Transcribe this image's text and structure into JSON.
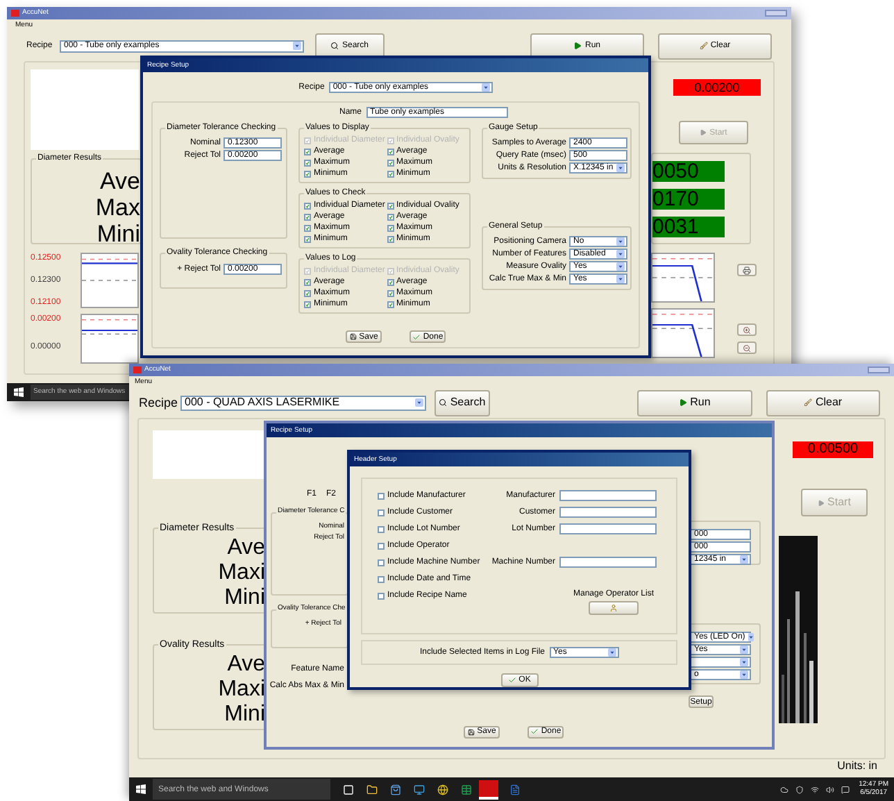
{
  "top_screen": {
    "window_title": "AccuNet",
    "menu": "Menu",
    "recipe_label": "Recipe",
    "recipe_value": "000 - Tube only examples",
    "search": "Search",
    "run": "Run",
    "clear": "Clear",
    "red_reading": "0.00200",
    "start": {
      "label": "Start",
      "disabled": true
    },
    "diameter_results": {
      "title": "Diameter Results",
      "rows": [
        "Ave",
        "Max",
        "Mini"
      ]
    },
    "green_readings": [
      "0050",
      "0170",
      "0031"
    ],
    "charts": [
      {
        "labels": [
          {
            "text": "0.12500",
            "limit": true
          },
          {
            "text": "0.12300",
            "limit": false
          },
          {
            "text": "0.12100",
            "limit": true
          }
        ]
      },
      {
        "labels": [
          {
            "text": "0.00200",
            "limit": true
          },
          {
            "text": "0.00000",
            "limit": false
          }
        ]
      }
    ],
    "taskbar_search": "Search the web and Windows",
    "recipe_setup": {
      "title": "Recipe Setup",
      "recipe_label": "Recipe",
      "recipe_value": "000 - Tube only examples",
      "name_label": "Name",
      "name_value": "Tube only examples",
      "diameter_tolerance": {
        "title": "Diameter Tolerance Checking",
        "fields": [
          {
            "label": "Nominal",
            "value": "0.12300"
          },
          {
            "label": "Reject Tol",
            "value": "0.00200"
          }
        ]
      },
      "ovality_tolerance": {
        "title": "Ovality Tolerance Checking",
        "fields": [
          {
            "label": "+ Reject Tol",
            "value": "0.00200"
          }
        ]
      },
      "value_groups": [
        {
          "title": "Values to Display",
          "items": [
            {
              "label": "Individual Diameter",
              "checked": true,
              "disabled": true
            },
            {
              "label": "Individual Ovality",
              "checked": true,
              "disabled": true
            },
            {
              "label": "Average",
              "checked": true,
              "disabled": false
            },
            {
              "label": "Average",
              "checked": true,
              "disabled": false
            },
            {
              "label": "Maximum",
              "checked": true,
              "disabled": false
            },
            {
              "label": "Maximum",
              "checked": true,
              "disabled": false
            },
            {
              "label": "Minimum",
              "checked": true,
              "disabled": false
            },
            {
              "label": "Minimum",
              "checked": true,
              "disabled": false
            }
          ]
        },
        {
          "title": "Values to Check",
          "items": [
            {
              "label": "Individual Diameter",
              "checked": true,
              "disabled": false
            },
            {
              "label": "Individual Ovality",
              "checked": true,
              "disabled": false
            },
            {
              "label": "Average",
              "checked": true,
              "disabled": false
            },
            {
              "label": "Average",
              "checked": true,
              "disabled": false
            },
            {
              "label": "Maximum",
              "checked": true,
              "disabled": false
            },
            {
              "label": "Maximum",
              "checked": true,
              "disabled": false
            },
            {
              "label": "Minimum",
              "checked": true,
              "disabled": false
            },
            {
              "label": "Minimum",
              "checked": true,
              "disabled": false
            }
          ]
        },
        {
          "title": "Values to Log",
          "items": [
            {
              "label": "Individual Diameter",
              "checked": true,
              "disabled": true
            },
            {
              "label": "Individual Ovality",
              "checked": true,
              "disabled": true
            },
            {
              "label": "Average",
              "checked": true,
              "disabled": false
            },
            {
              "label": "Average",
              "checked": true,
              "disabled": false
            },
            {
              "label": "Maximum",
              "checked": true,
              "disabled": false
            },
            {
              "label": "Maximum",
              "checked": true,
              "disabled": false
            },
            {
              "label": "Minimum",
              "checked": true,
              "disabled": false
            },
            {
              "label": "Minimum",
              "checked": true,
              "disabled": false
            }
          ]
        }
      ],
      "gauge_setup": {
        "title": "Gauge Setup",
        "fields": [
          {
            "label": "Samples to Average",
            "value": "2400",
            "kind": "text"
          },
          {
            "label": "Query Rate (msec)",
            "value": "500",
            "kind": "text"
          },
          {
            "label": "Units & Resolution",
            "value": "X.12345 in",
            "kind": "select"
          }
        ]
      },
      "general_setup": {
        "title": "General Setup",
        "fields": [
          {
            "label": "Positioning Camera",
            "value": "No",
            "kind": "select"
          },
          {
            "label": "Number of Features",
            "value": "Disabled",
            "kind": "select"
          },
          {
            "label": "Measure Ovality",
            "value": "Yes",
            "kind": "select"
          },
          {
            "label": "Calc True Max & Min",
            "value": "Yes",
            "kind": "select"
          }
        ]
      },
      "save": "Save",
      "done": "Done"
    }
  },
  "bottom_screen": {
    "window_title": "AccuNet",
    "menu": "Menu",
    "recipe_label": "Recipe",
    "recipe_value": "000 - QUAD AXIS LASERMIKE",
    "search": "Search",
    "run": "Run",
    "clear": "Clear",
    "red_reading": "0.00500",
    "start": {
      "label": "Start",
      "disabled": true
    },
    "diameter_results": {
      "title": "Diameter Results",
      "rows": [
        "Ave",
        "Maxi",
        "Mini"
      ]
    },
    "ovality_results": {
      "title": "Ovality Results",
      "rows": [
        "Ave",
        "Maxi",
        "Mini"
      ]
    },
    "units": "Units: in",
    "recipe_setup": {
      "title": "Recipe Setup",
      "feature_tabs": [
        "F1",
        "F2"
      ],
      "diameter_group": "Diameter Tolerance C",
      "diameter_labels": [
        "Nominal",
        "Reject Tol"
      ],
      "ovality_group": "Ovality Tolerance Che",
      "ovality_labels": [
        "+ Reject Tol"
      ],
      "feature_name": "Feature Name",
      "calc_label": "Calc Abs Max & Min",
      "gauge_fragments": [
        {
          "value": "000",
          "kind": "text"
        },
        {
          "value": "000",
          "kind": "text"
        },
        {
          "value": "12345 in",
          "kind": "select"
        }
      ],
      "general_fragments": [
        {
          "kind": "select",
          "value": "Yes (LED On)"
        },
        {
          "kind": "select",
          "value": "Yes"
        },
        {
          "kind": "select"
        },
        {
          "kind": "select",
          "value": "o"
        }
      ],
      "setup": "Setup",
      "save": "Save",
      "done": "Done"
    },
    "header_setup": {
      "title": "Header Setup",
      "items": [
        {
          "label": "Include Manufacturer",
          "checked": false,
          "field_label": "Manufacturer"
        },
        {
          "label": "Include Customer",
          "checked": false,
          "field_label": "Customer"
        },
        {
          "label": "Include Lot Number",
          "checked": false,
          "field_label": "Lot Number"
        },
        {
          "label": "Include Operator",
          "checked": false
        },
        {
          "label": "Include Machine Number",
          "checked": false,
          "field_label": "Machine Number"
        },
        {
          "label": "Include Date and Time",
          "checked": false
        },
        {
          "label": "Include Recipe Name",
          "checked": false
        }
      ],
      "manage_label": "Manage Operator List",
      "log_label": "Include Selected Items in Log File",
      "log_value": "Yes",
      "ok": "OK"
    },
    "taskbar": {
      "search": "Search the web and Windows",
      "time": "12:47 PM",
      "date": "6/5/2017"
    }
  }
}
